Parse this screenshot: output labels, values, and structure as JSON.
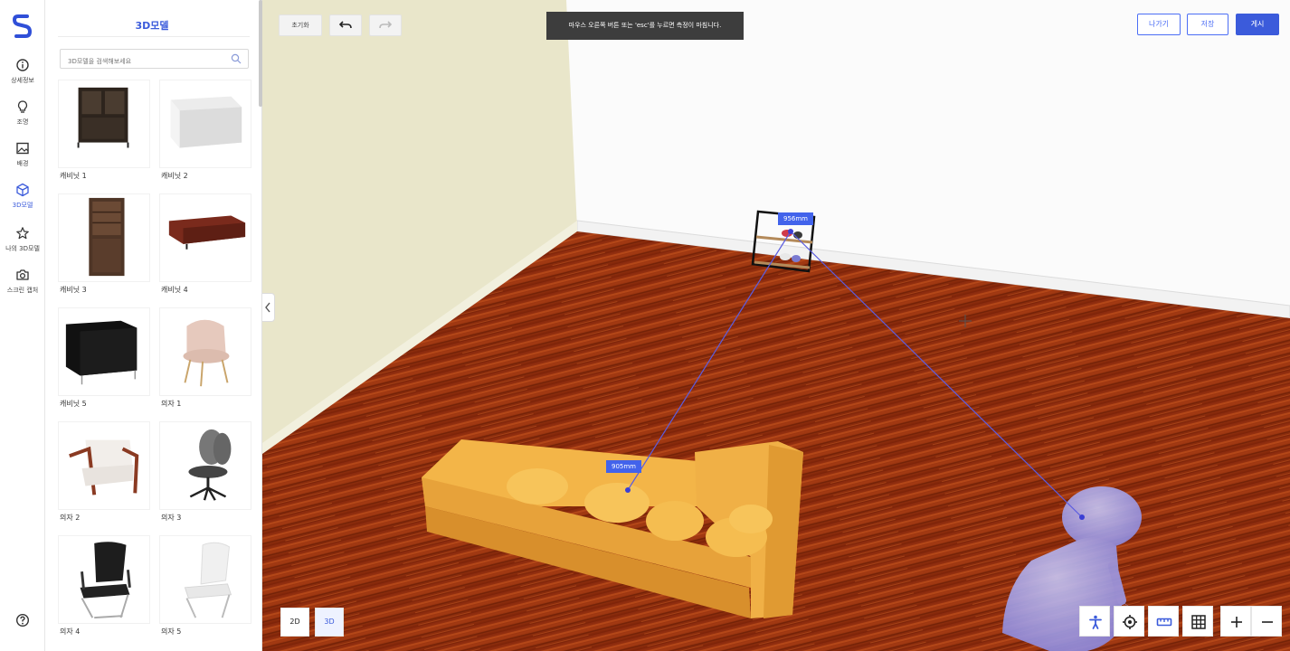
{
  "rail": {
    "items": [
      {
        "label": "상세정보",
        "icon": "info-icon"
      },
      {
        "label": "조명",
        "icon": "lightbulb-icon"
      },
      {
        "label": "배경",
        "icon": "image-icon"
      },
      {
        "label": "3D모델",
        "icon": "cube-icon",
        "active": true
      },
      {
        "label": "나의 3D모델",
        "icon": "star-icon"
      },
      {
        "label": "스크린 캡처",
        "icon": "camera-icon"
      }
    ],
    "help_icon": "help-icon",
    "accent": "#3b5bdb"
  },
  "panel": {
    "title": "3D모델",
    "search_placeholder": "3D모델을 검색해보세요",
    "items": [
      {
        "label": "캐비닛 1"
      },
      {
        "label": "캐비닛 2"
      },
      {
        "label": "캐비닛 3"
      },
      {
        "label": "캐비닛 4"
      },
      {
        "label": "캐비닛 5"
      },
      {
        "label": "의자 1"
      },
      {
        "label": "의자 2"
      },
      {
        "label": "의자 3"
      },
      {
        "label": "의자 4"
      },
      {
        "label": "의자 5"
      }
    ]
  },
  "toolbar": {
    "reset_label": "초기화",
    "undo_icon": "undo-icon",
    "redo_icon": "redo-icon",
    "toast": "마우스 오른쪽 버튼 또는 'esc'를 누르면 측정이 마침니다.",
    "exit_label": "나가기",
    "save_label": "저장",
    "publish_label": "게시"
  },
  "measurements": [
    {
      "label": "956mm"
    },
    {
      "label": "905mm"
    }
  ],
  "view_modes": {
    "two_d": "2D",
    "three_d": "3D",
    "active": "3D"
  },
  "tools": [
    "person-icon",
    "target-icon",
    "ruler-icon",
    "grid-icon",
    "zoom-in-icon",
    "zoom-out-icon"
  ]
}
